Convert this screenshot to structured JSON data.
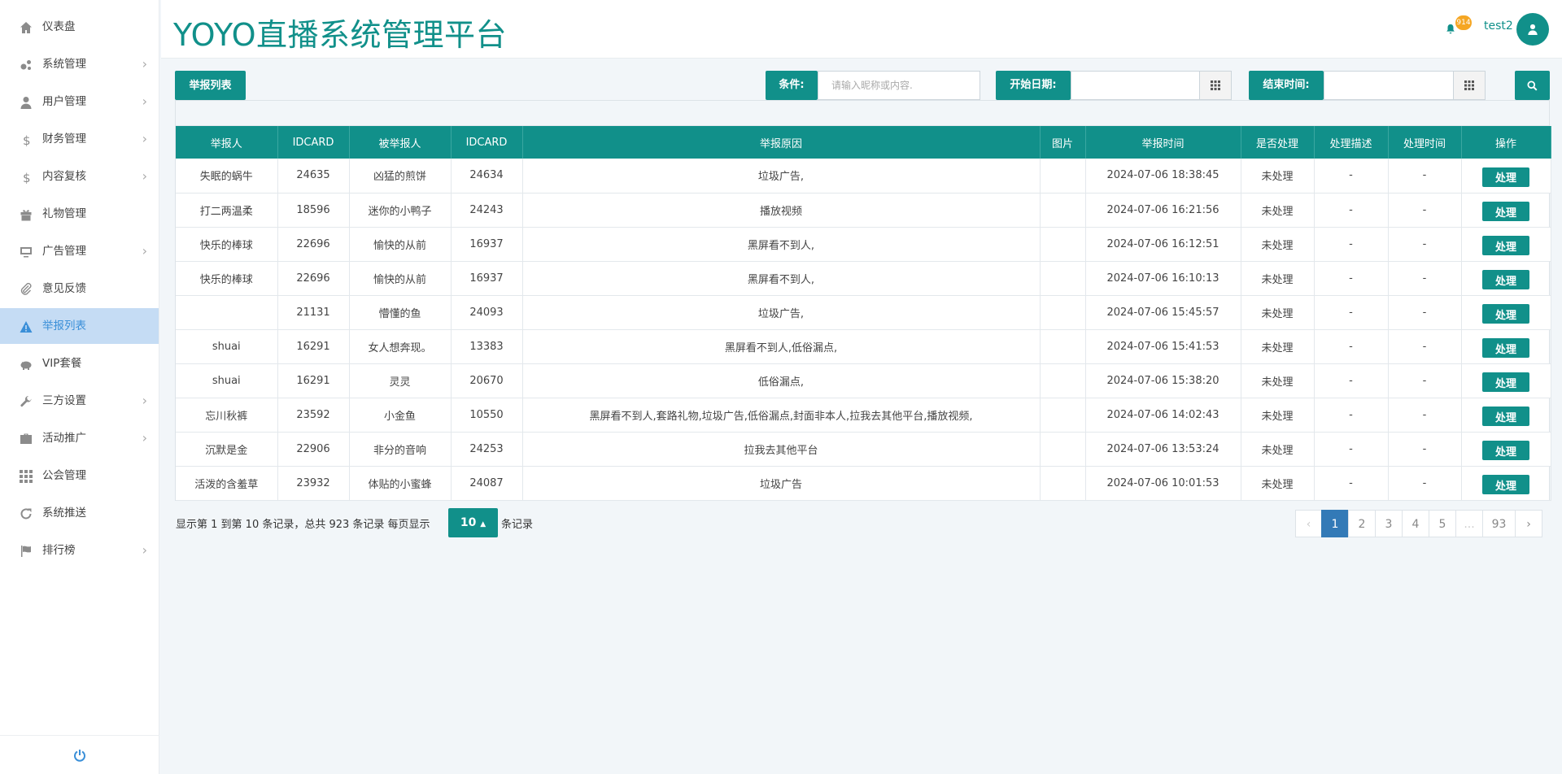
{
  "sidebar": {
    "items": [
      {
        "label": "仪表盘",
        "icon": "home-icon",
        "has_children": false
      },
      {
        "label": "系统管理",
        "icon": "gears-icon",
        "has_children": true
      },
      {
        "label": "用户管理",
        "icon": "user-icon",
        "has_children": true
      },
      {
        "label": "财务管理",
        "icon": "dollar-icon",
        "has_children": true
      },
      {
        "label": "内容复核",
        "icon": "dollar-icon",
        "has_children": true
      },
      {
        "label": "礼物管理",
        "icon": "gift-icon",
        "has_children": false
      },
      {
        "label": "广告管理",
        "icon": "monitor-icon",
        "has_children": true
      },
      {
        "label": "意见反馈",
        "icon": "paperclip-icon",
        "has_children": false
      },
      {
        "label": "举报列表",
        "icon": "warning-icon",
        "has_children": false,
        "active": true
      },
      {
        "label": "VIP套餐",
        "icon": "piggy-bank-icon",
        "has_children": false
      },
      {
        "label": "三方设置",
        "icon": "wrench-icon",
        "has_children": true
      },
      {
        "label": "活动推广",
        "icon": "briefcase-icon",
        "has_children": true
      },
      {
        "label": "公会管理",
        "icon": "grid-icon",
        "has_children": false
      },
      {
        "label": "系统推送",
        "icon": "refresh-icon",
        "has_children": false
      },
      {
        "label": "排行榜",
        "icon": "flag-icon",
        "has_children": true
      }
    ],
    "footer_icon": "power-icon"
  },
  "header": {
    "title": "YOYO直播系统管理平台",
    "notification_count": "914",
    "username": "test2"
  },
  "toolbar": {
    "list_button": "举报列表",
    "condition_label": "条件:",
    "condition_placeholder": "请输入昵称或内容.",
    "start_label": "开始日期:",
    "end_label": "结束时间:"
  },
  "table": {
    "columns": [
      "举报人",
      "IDCARD",
      "被举报人",
      "IDCARD",
      "举报原因",
      "图片",
      "举报时间",
      "是否处理",
      "处理描述",
      "处理时间",
      "操作"
    ],
    "action_label": "处理",
    "rows": [
      {
        "reporter": "失眠的蜗牛",
        "reporter_id": "24635",
        "reported": "凶猛的煎饼",
        "reported_id": "24634",
        "reason": "垃圾广告,",
        "image": "",
        "time": "2024-07-06 18:38:45",
        "status": "未处理",
        "desc": "-",
        "handled_time": "-"
      },
      {
        "reporter": "打二两温柔",
        "reporter_id": "18596",
        "reported": "迷你的小鸭子",
        "reported_id": "24243",
        "reason": "播放视频",
        "image": "",
        "time": "2024-07-06 16:21:56",
        "status": "未处理",
        "desc": "-",
        "handled_time": "-"
      },
      {
        "reporter": "快乐的棒球",
        "reporter_id": "22696",
        "reported": "愉快的从前",
        "reported_id": "16937",
        "reason": "黑屏看不到人,",
        "image": "",
        "time": "2024-07-06 16:12:51",
        "status": "未处理",
        "desc": "-",
        "handled_time": "-"
      },
      {
        "reporter": "快乐的棒球",
        "reporter_id": "22696",
        "reported": "愉快的从前",
        "reported_id": "16937",
        "reason": "黑屏看不到人,",
        "image": "",
        "time": "2024-07-06 16:10:13",
        "status": "未处理",
        "desc": "-",
        "handled_time": "-"
      },
      {
        "reporter": "",
        "reporter_id": "21131",
        "reported": "懵懂的鱼",
        "reported_id": "24093",
        "reason": "垃圾广告,",
        "image": "",
        "time": "2024-07-06 15:45:57",
        "status": "未处理",
        "desc": "-",
        "handled_time": "-"
      },
      {
        "reporter": "shuai",
        "reporter_id": "16291",
        "reported": "女人想奔现。",
        "reported_id": "13383",
        "reason": "黑屏看不到人,低俗漏点,",
        "image": "",
        "time": "2024-07-06 15:41:53",
        "status": "未处理",
        "desc": "-",
        "handled_time": "-"
      },
      {
        "reporter": "shuai",
        "reporter_id": "16291",
        "reported": "灵灵",
        "reported_id": "20670",
        "reason": "低俗漏点,",
        "image": "",
        "time": "2024-07-06 15:38:20",
        "status": "未处理",
        "desc": "-",
        "handled_time": "-"
      },
      {
        "reporter": "忘川秋裤",
        "reporter_id": "23592",
        "reported": "小金鱼",
        "reported_id": "10550",
        "reason": "黑屏看不到人,套路礼物,垃圾广告,低俗漏点,封面非本人,拉我去其他平台,播放视频,",
        "image": "",
        "time": "2024-07-06 14:02:43",
        "status": "未处理",
        "desc": "-",
        "handled_time": "-"
      },
      {
        "reporter": "沉默是金",
        "reporter_id": "22906",
        "reported": "非分的音响",
        "reported_id": "24253",
        "reason": "拉我去其他平台",
        "image": "",
        "time": "2024-07-06 13:53:24",
        "status": "未处理",
        "desc": "-",
        "handled_time": "-"
      },
      {
        "reporter": "活泼的含羞草",
        "reporter_id": "23932",
        "reported": "体贴的小蜜蜂",
        "reported_id": "24087",
        "reason": "垃圾广告",
        "image": "",
        "time": "2024-07-06 10:01:53",
        "status": "未处理",
        "desc": "-",
        "handled_time": "-"
      }
    ]
  },
  "pagination": {
    "info": "显示第 1 到第 10 条记录，总共 923 条记录 每页显示",
    "page_size": "10",
    "suffix": "条记录",
    "pages": [
      {
        "label": "‹",
        "state": "disabled"
      },
      {
        "label": "1",
        "state": "active"
      },
      {
        "label": "2",
        "state": ""
      },
      {
        "label": "3",
        "state": ""
      },
      {
        "label": "4",
        "state": ""
      },
      {
        "label": "5",
        "state": ""
      },
      {
        "label": "...",
        "state": "disabled"
      },
      {
        "label": "93",
        "state": ""
      },
      {
        "label": "›",
        "state": ""
      }
    ]
  },
  "colors": {
    "accent": "#11908a",
    "active_page": "#337ab7",
    "sidebar_active": "#c5dcf4",
    "badge": "#f5a623"
  }
}
